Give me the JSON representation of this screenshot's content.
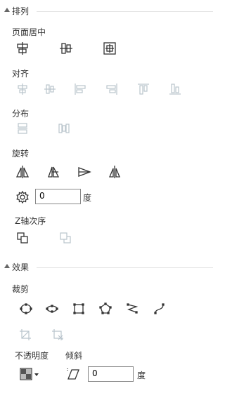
{
  "sections": {
    "arrange": "排列",
    "effects": "效果"
  },
  "arrange": {
    "page_center": "页面居中",
    "align": "对齐",
    "distribute": "分布",
    "rotate": "旋转",
    "rotate_value": "0",
    "rotate_unit": "度",
    "z_order": "Z轴次序"
  },
  "effects": {
    "crop": "裁剪",
    "opacity": "不透明度",
    "skew": "倾斜",
    "skew_value": "0",
    "skew_unit": "度"
  },
  "colors": {
    "active_icon": "#333333",
    "disabled_icon": "#b9c4cc",
    "divider": "#e3e3e3"
  }
}
